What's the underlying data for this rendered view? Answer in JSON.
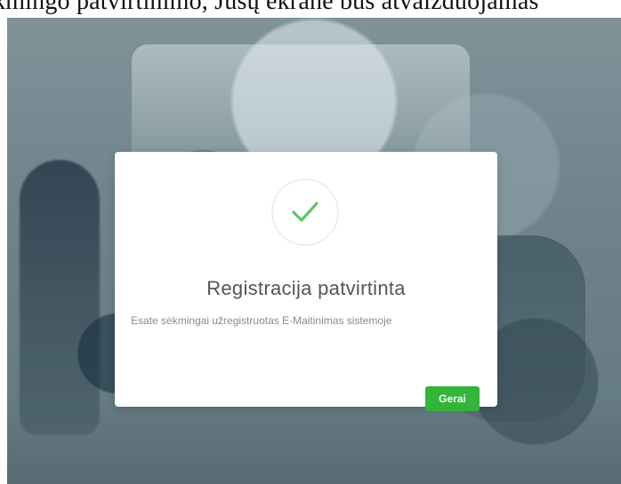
{
  "document": {
    "text_line": "kmingo  patvirtinimo,  Jūsų ekrane bus atvaizduojamas"
  },
  "modal": {
    "title": "Registracija patvirtinta",
    "message": "Esate sėkmingai užregistruotas E-Maitinimas sistemoje",
    "ok_button_label": "Gerai",
    "icon": "check-icon"
  },
  "colors": {
    "accent_green": "#32b539",
    "check_circle": "#e7f3e6",
    "overlay_bg": "#6f858b"
  }
}
